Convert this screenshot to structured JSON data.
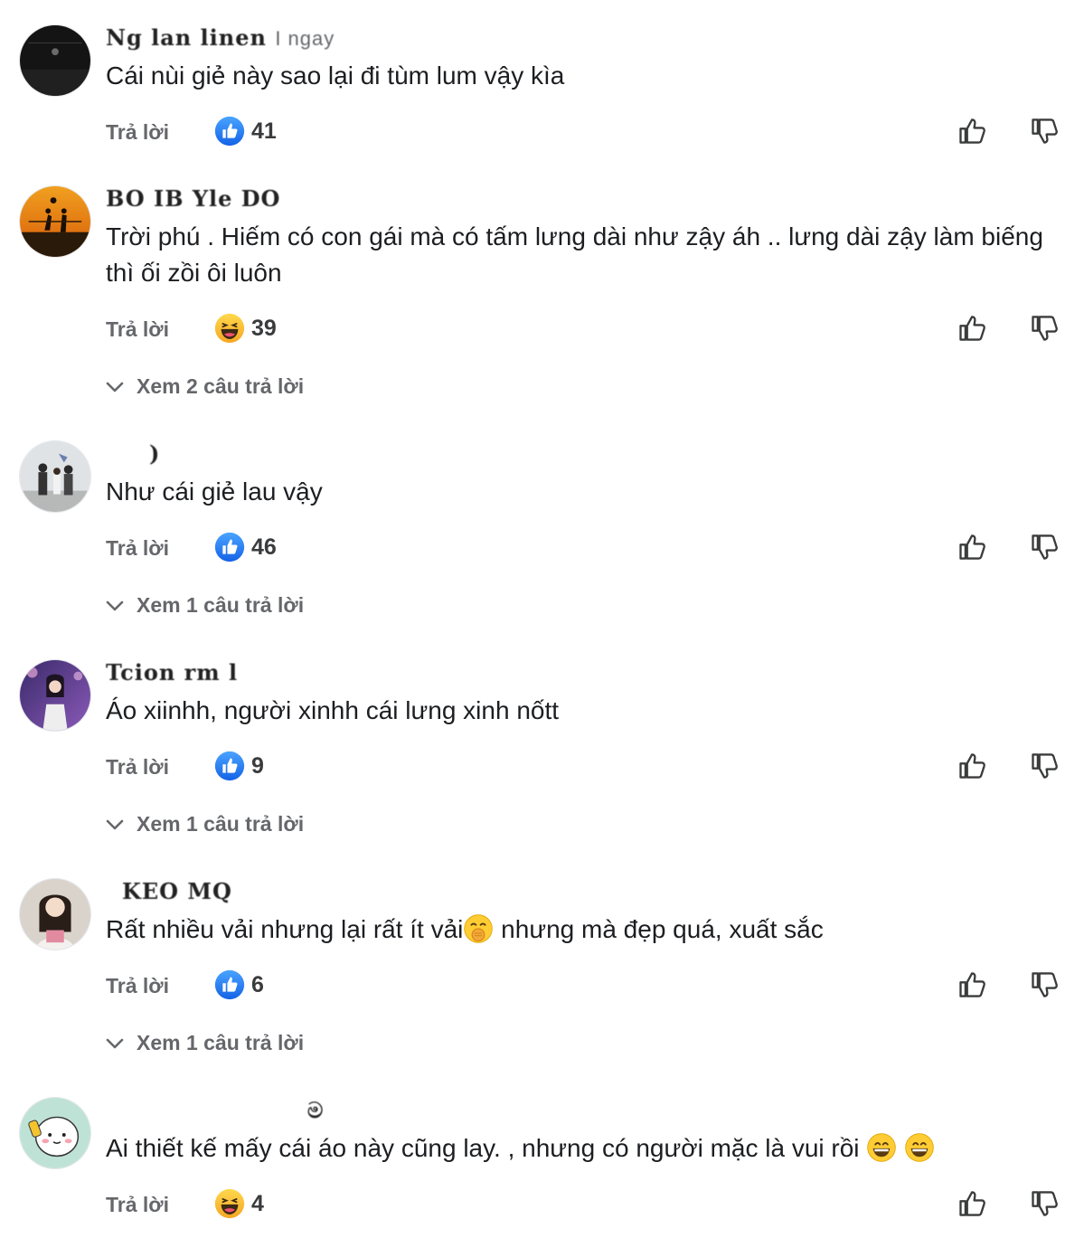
{
  "comments": [
    {
      "name": "Ng lan linen",
      "time": "I ngay",
      "text": "Cái nùi giẻ này sao lại đi tùm lum vậy kìa",
      "reply_label": "Trả lời",
      "reaction": "like",
      "count": "41",
      "more": ""
    },
    {
      "name": "BO IB    Yle      DO",
      "time": "",
      "text": "Trời phú . Hiếm có con gái mà có tấm lưng dài như zậy áh .. lưng dài zậy làm biếng thì ối zồi ôi luôn",
      "reply_label": "Trả lời",
      "reaction": "haha",
      "count": "39",
      "more": "Xem 2 câu trả lời"
    },
    {
      "name": ")",
      "time": "",
      "text": "Như cái giẻ lau vậy",
      "reply_label": "Trả lời",
      "reaction": "like",
      "count": "46",
      "more": "Xem 1 câu trả lời"
    },
    {
      "name": "Tcion  rm      l",
      "time": "",
      "text": "Áo xiinhh,  người xinhh cái lưng xinh nốtt",
      "reply_label": "Trả lời",
      "reaction": "like",
      "count": "9",
      "more": "Xem 1 câu trả lời"
    },
    {
      "name": "KEO    MQ",
      "time": "",
      "text_before": "Rất nhiều vải nhưng lại rất ít vải",
      "emoji": "hand-over-mouth-emoji",
      "text_after": " nhưng mà đẹp quá, xuất sắc",
      "reply_label": "Trả lời",
      "reaction": "like",
      "count": "6",
      "more": "Xem 1 câu trả lời"
    },
    {
      "name": "ම",
      "time": "",
      "text": "Ai thiết kế mấy cái áo này cũng lay. , nhưng có người mặc là vui rồi ",
      "emoji": "grinning-emoji",
      "reply_label": "Trả lời",
      "reaction": "haha",
      "count": "4",
      "more": ""
    }
  ],
  "colors": {
    "like_blue": "#1877f2",
    "haha_yellow": "#f7b928",
    "secondary_text": "#65676b"
  }
}
